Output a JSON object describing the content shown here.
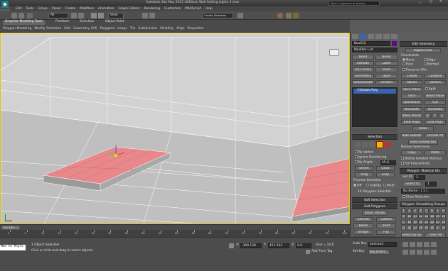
{
  "title_bar": {
    "title": "Autodesk 3ds Max 2013 x64",
    "file": "Back Wall-Setting Lights 3.max",
    "search_placeholder": "Type a keyword or phrase"
  },
  "menu": [
    "Edit",
    "Tools",
    "Group",
    "Views",
    "Create",
    "Modifiers",
    "Animation",
    "Graph Editors",
    "Rendering",
    "Customize",
    "MAXScript",
    "Help"
  ],
  "toolbar": {
    "selection_filter": "All",
    "view_dropdown": "View",
    "named_selection": "Create Selection"
  },
  "ribbon": {
    "tabs": [
      "Graphite Modeling Tools",
      "Freeform",
      "Selection",
      "Object Paint"
    ],
    "subtabs": [
      "Polygon Modeling",
      "Modify Selection",
      "Edit",
      "Geometry (All)",
      "Polygons",
      "Loops",
      "Tris",
      "Subdivision",
      "Visibility",
      "Align",
      "Properties"
    ]
  },
  "viewport": {
    "label": "[+] [Perspective] [Realistic]"
  },
  "modify_panel": {
    "object_name": "Box012",
    "modifier_list_label": "Modifier List",
    "modifier_buttons": [
      "Bend",
      "Bevel",
      "Extrude",
      "Lathe",
      "FFD 3x3x3",
      "Shell",
      "Symmetry",
      "Taper",
      "TurboSmooth",
      "Smooth"
    ],
    "stack_item": "Editable Poly",
    "selection_title": "Selection",
    "by_vertex": "By Vertex",
    "ignore_backfacing": "Ignore Backfacing",
    "by_angle": "By Angle:",
    "by_angle_value": "45.0",
    "shrink": "Shrink",
    "grow": "Grow",
    "ring": "Ring",
    "loop": "Loop",
    "preview_selection": "Preview Selection",
    "preview_off": "Off",
    "preview_subobj": "SubObj",
    "preview_multi": "Multi",
    "selected_count": "14 Polygons Selected",
    "soft_selection": "Soft Selection",
    "edit_polygons": "Edit Polygons",
    "insert_vertex": "Insert Vertex",
    "extrude": "Extrude",
    "outline": "Outline",
    "bevel": "Bevel",
    "inset": "Inset",
    "bridge": "Bridge",
    "flip": "Flip",
    "hinge_from_edge": "Hinge From Edge",
    "extrude_along_spline": "Extrude Along Spline",
    "edit_triangulation": "Edit Triangulation",
    "retriangulate": "Retriangulate",
    "turn": "Turn"
  },
  "edit_geometry": {
    "title": "Edit Geometry",
    "repeat_last": "Repeat Last",
    "constraints": "Constraints",
    "none": "None",
    "edge": "Edge",
    "face": "Face",
    "normal": "Normal",
    "preserve_uvs": "Preserve UVs",
    "create": "Create",
    "collapse": "Collapse",
    "attach": "Attach",
    "detach": "Detach",
    "slice_plane": "Slice Plane",
    "split": "Split",
    "slice": "Slice",
    "reset_plane": "Reset Plane",
    "quickslice": "QuickSlice",
    "cut": "Cut",
    "msmooth": "MSmooth",
    "tessellate": "Tessellate",
    "make_planar": "Make Planar",
    "x": "X",
    "y": "Y",
    "z": "Z",
    "view_align": "View Align",
    "grid_align": "Grid Align",
    "relax": "Relax",
    "hide_selected": "Hide Selected",
    "unhide_all": "Unhide All",
    "hide_unselected": "Hide Unselected",
    "named_selections": "Named Selections:",
    "copy": "Copy",
    "paste": "Paste",
    "delete_isolated": "Delete Isolated Vertices",
    "full_interactivity": "Full Interactivity"
  },
  "material_ids": {
    "title": "Polygon: Material IDs",
    "set_id": "Set ID:",
    "set_id_value": "1",
    "select_id": "Select ID",
    "select_id_value": "1",
    "name_value": "No Name - ( 1 )",
    "clear_selection": "Clear Selection"
  },
  "smoothing": {
    "title": "Polygon: Smoothing Groups",
    "groups": [
      "1",
      "2",
      "3",
      "4",
      "5",
      "6",
      "7",
      "8",
      "9",
      "10",
      "11",
      "12",
      "13",
      "14",
      "15",
      "16",
      "17",
      "18",
      "19",
      "20",
      "21",
      "22",
      "23",
      "24",
      "25",
      "26",
      "27",
      "28",
      "29",
      "30",
      "31",
      "32"
    ],
    "select_by_sg": "Select By SG",
    "clear_all": "Clear All",
    "auto_smooth": "Auto Smooth",
    "auto_smooth_value": "45.0"
  },
  "vertex_colors": {
    "title": "Polygon: Vertex Colors",
    "color": "Color:"
  },
  "timeline": {
    "frame": "0 / 100",
    "ticks": [
      "0",
      "5",
      "10",
      "15",
      "20",
      "25",
      "30",
      "35",
      "40",
      "45",
      "50",
      "55",
      "60",
      "65",
      "70",
      "75",
      "80",
      "85",
      "90",
      "95",
      "100"
    ]
  },
  "status": {
    "maxscript": "Max to Physc",
    "selected": "1 Object Selected",
    "prompt": "Click or click-and-drag to select objects",
    "x_label": "X:",
    "x_value": "-300.138",
    "y_label": "Y:",
    "y_value": "421.503",
    "z_label": "Z:",
    "z_value": "0.0",
    "grid": "Grid = 10.0",
    "add_time_tag": "Add Time Tag",
    "auto_key": "Auto Key",
    "auto_key_value": "Selected",
    "set_key": "Set Key",
    "key_filters": "Key Filters..."
  },
  "colors": {
    "accent_selection": "#e8888a",
    "panel": "#5a5a5a",
    "viewport_bg": "#c8c8c8"
  }
}
